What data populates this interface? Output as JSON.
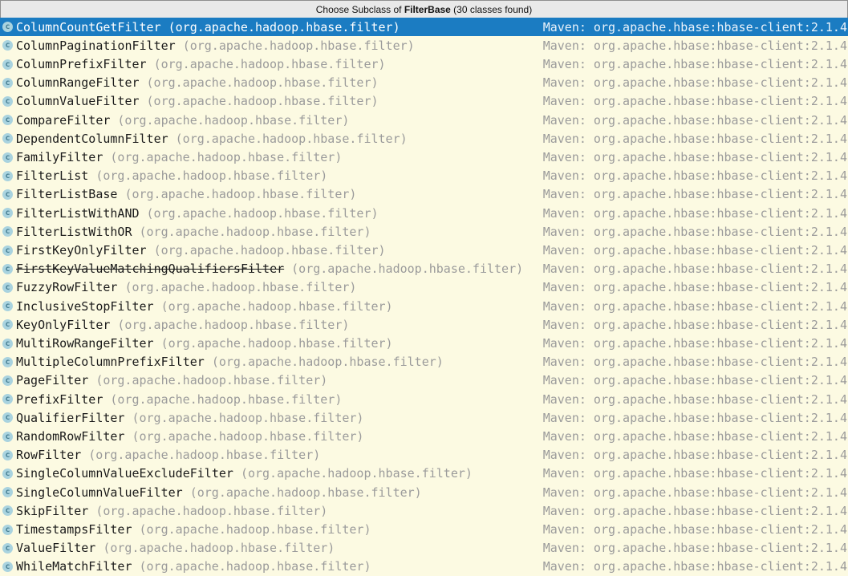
{
  "popup": {
    "title": {
      "prefix": "Choose Subclass of ",
      "highlight": "FilterBase",
      "suffix": " (30 classes found)"
    }
  },
  "list": {
    "package_label": "(org.apache.hadoop.hbase.filter)",
    "maven_label": "Maven: org.apache.hbase:hbase-client:2.1.4",
    "icon": {
      "name": "class-icon",
      "glyph": "c"
    },
    "classes": [
      {
        "name": "ColumnCountGetFilter",
        "selected": true,
        "deprecated": false
      },
      {
        "name": "ColumnPaginationFilter",
        "selected": false,
        "deprecated": false
      },
      {
        "name": "ColumnPrefixFilter",
        "selected": false,
        "deprecated": false
      },
      {
        "name": "ColumnRangeFilter",
        "selected": false,
        "deprecated": false
      },
      {
        "name": "ColumnValueFilter",
        "selected": false,
        "deprecated": false
      },
      {
        "name": "CompareFilter",
        "selected": false,
        "deprecated": false
      },
      {
        "name": "DependentColumnFilter",
        "selected": false,
        "deprecated": false
      },
      {
        "name": "FamilyFilter",
        "selected": false,
        "deprecated": false
      },
      {
        "name": "FilterList",
        "selected": false,
        "deprecated": false
      },
      {
        "name": "FilterListBase",
        "selected": false,
        "deprecated": false
      },
      {
        "name": "FilterListWithAND",
        "selected": false,
        "deprecated": false
      },
      {
        "name": "FilterListWithOR",
        "selected": false,
        "deprecated": false
      },
      {
        "name": "FirstKeyOnlyFilter",
        "selected": false,
        "deprecated": false
      },
      {
        "name": "FirstKeyValueMatchingQualifiersFilter",
        "selected": false,
        "deprecated": true
      },
      {
        "name": "FuzzyRowFilter",
        "selected": false,
        "deprecated": false
      },
      {
        "name": "InclusiveStopFilter",
        "selected": false,
        "deprecated": false
      },
      {
        "name": "KeyOnlyFilter",
        "selected": false,
        "deprecated": false
      },
      {
        "name": "MultiRowRangeFilter",
        "selected": false,
        "deprecated": false
      },
      {
        "name": "MultipleColumnPrefixFilter",
        "selected": false,
        "deprecated": false
      },
      {
        "name": "PageFilter",
        "selected": false,
        "deprecated": false
      },
      {
        "name": "PrefixFilter",
        "selected": false,
        "deprecated": false
      },
      {
        "name": "QualifierFilter",
        "selected": false,
        "deprecated": false
      },
      {
        "name": "RandomRowFilter",
        "selected": false,
        "deprecated": false
      },
      {
        "name": "RowFilter",
        "selected": false,
        "deprecated": false
      },
      {
        "name": "SingleColumnValueExcludeFilter",
        "selected": false,
        "deprecated": false
      },
      {
        "name": "SingleColumnValueFilter",
        "selected": false,
        "deprecated": false
      },
      {
        "name": "SkipFilter",
        "selected": false,
        "deprecated": false
      },
      {
        "name": "TimestampsFilter",
        "selected": false,
        "deprecated": false
      },
      {
        "name": "ValueFilter",
        "selected": false,
        "deprecated": false
      },
      {
        "name": "WhileMatchFilter",
        "selected": false,
        "deprecated": false
      }
    ]
  },
  "colors": {
    "selection_bg": "#1B7CC2",
    "row_bg": "#FCFAE2",
    "header_bg": "#E9E9E9",
    "header_border": "#8F8F8F",
    "name_color": "#1A1A1A",
    "package_color": "#9B9B9B",
    "maven_color": "#9B9B9B",
    "selected_primary": "#FFFFFF",
    "selected_secondary": "#EAF2FA",
    "icon_bg": "#A9D3DF",
    "icon_glyph_color": "#467E92"
  }
}
